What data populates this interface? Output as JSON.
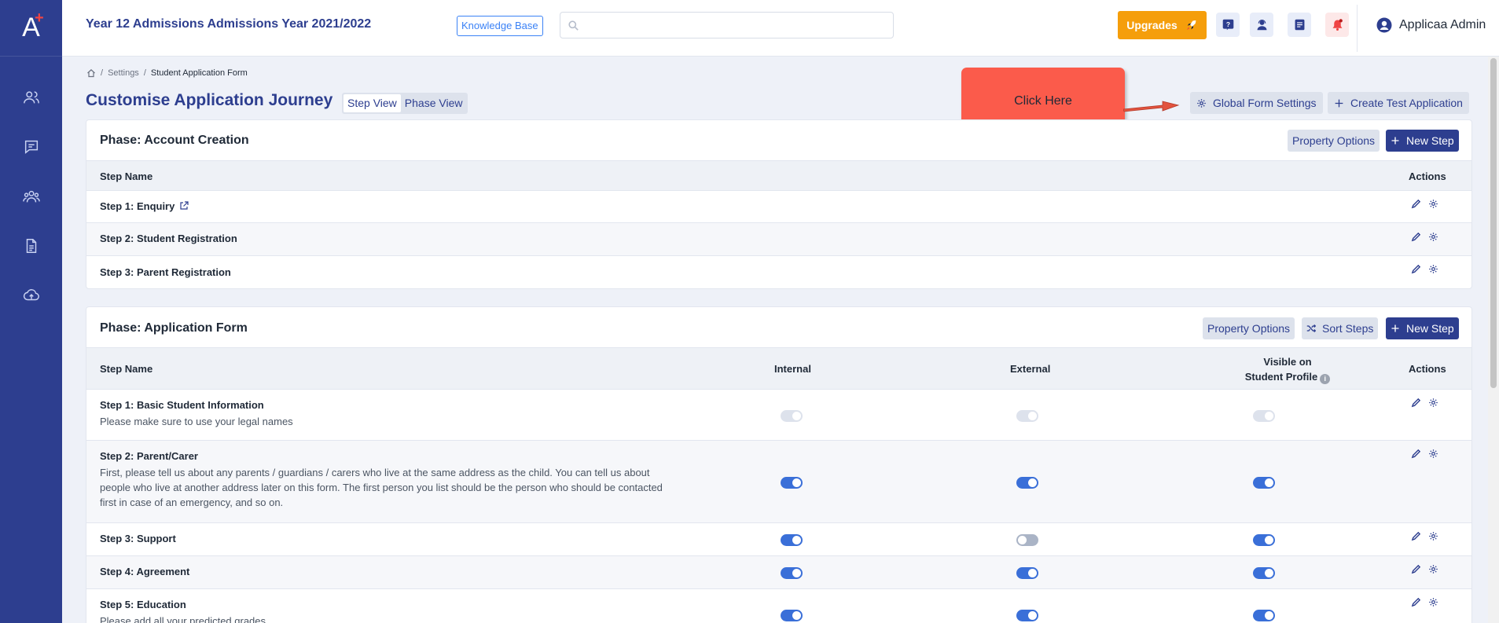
{
  "topbar": {
    "title": "Year 12 Admissions Admissions Year 2021/2022",
    "knowledge_base": "Knowledge Base",
    "search_placeholder": "",
    "upgrades": "Upgrades",
    "user_name": "Applicaa Admin"
  },
  "sidebar": {
    "logo": "A",
    "items": [
      "users-icon",
      "chat-icon",
      "group-icon",
      "document-icon",
      "cloud-upload-icon"
    ]
  },
  "breadcrumb": [
    "Settings",
    "Student Application Form"
  ],
  "page": {
    "title": "Customise Application Journey",
    "view_step": "Step View",
    "view_phase": "Phase View",
    "global_settings": "Global Form Settings",
    "create_test": "Create Test Application"
  },
  "callout": {
    "text": "Click Here",
    "color": "#fb5b4b"
  },
  "phase1": {
    "title": "Phase: Account Creation",
    "property_options": "Property Options",
    "new_step": "New Step",
    "col_step": "Step Name",
    "col_actions": "Actions",
    "steps": [
      {
        "name": "Step 1: Enquiry"
      },
      {
        "name": "Step 2: Student Registration"
      },
      {
        "name": "Step 3: Parent Registration"
      }
    ]
  },
  "phase2": {
    "title": "Phase: Application Form",
    "property_options": "Property Options",
    "sort_steps": "Sort Steps",
    "new_step": "New Step",
    "col_step": "Step Name",
    "col_internal": "Internal",
    "col_external": "External",
    "col_visible_1": "Visible on",
    "col_visible_2": "Student Profile",
    "col_actions": "Actions",
    "steps": [
      {
        "name": "Step 1: Basic Student Information",
        "desc": "Please make sure to use your legal names",
        "internal": "disabled",
        "external": "disabled",
        "visible": "disabled"
      },
      {
        "name": "Step 2: Parent/Carer",
        "desc": "First, please tell us about any parents / guardians / carers who live at the same address as the child. You can tell us about people who live at another address later on this form. The first person you list should be the person who should be contacted first in case of an emergency, and so on.",
        "internal": "on",
        "external": "on",
        "visible": "on"
      },
      {
        "name": "Step 3: Support",
        "desc": "",
        "internal": "on",
        "external": "off",
        "visible": "on"
      },
      {
        "name": "Step 4: Agreement",
        "desc": "",
        "internal": "on",
        "external": "on",
        "visible": "on"
      },
      {
        "name": "Step 5: Education",
        "desc": "Please add all your predicted grades",
        "internal": "on",
        "external": "on",
        "visible": "on"
      }
    ]
  },
  "colors": {
    "brand": "#2d3e8f",
    "accent": "#f59e0b",
    "toggle_on": "#3a6fd8"
  }
}
